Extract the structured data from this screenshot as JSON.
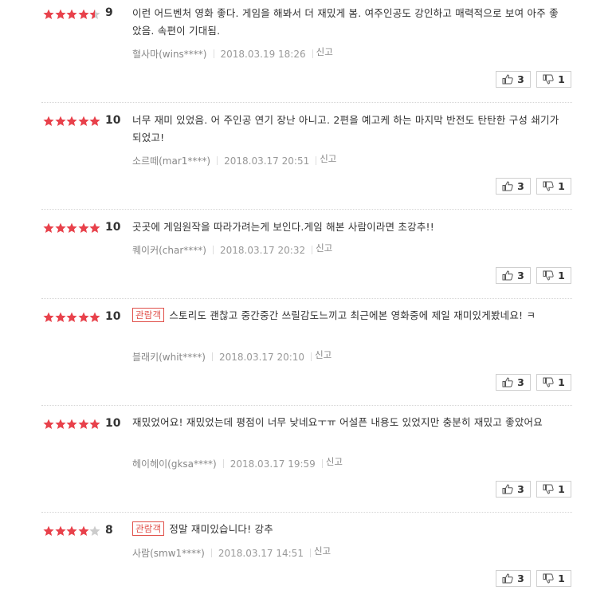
{
  "colors": {
    "star_on": "#e8414b",
    "star_off": "#cccccc",
    "badge": "#e0504a"
  },
  "reviews": [
    {
      "rating": 4.5,
      "score": "9",
      "badge": "",
      "text": "이런 어드벤처 영화 좋다. 게임을 해봐서 더 재밌게 봄. 여주인공도 강인하고 매력적으로 보여 아주 좋았음. 속편이 기대됨.",
      "author": "혈사마(wins****)",
      "date": "2018.03.19 18:26",
      "report": "신고",
      "likes": "3",
      "dislikes": "1"
    },
    {
      "rating": 5,
      "score": "10",
      "badge": "",
      "text": "너무 재미 있었음. 어 주인공 연기 장난 아니고. 2편을 예고케 하는 마지막 반전도 탄탄한 구성 쇄기가 되었고!",
      "author": "소르떼(mar1****)",
      "date": "2018.03.17 20:51",
      "report": "신고",
      "likes": "3",
      "dislikes": "1"
    },
    {
      "rating": 5,
      "score": "10",
      "badge": "",
      "text": "곳곳에 게임원작을 따라가려는게 보인다.게임 해본 사람이라면 초강추!!",
      "author": "퀘이커(char****)",
      "date": "2018.03.17 20:32",
      "report": "신고",
      "likes": "3",
      "dislikes": "1"
    },
    {
      "rating": 5,
      "score": "10",
      "badge": "관람객",
      "text": "스토리도 괜찮고 중간중간 쓰릴감도느끼고 최근에본 영화중에 제일 재미있게봤네요! ㅋ",
      "author": "블래키(whit****)",
      "date": "2018.03.17 20:10",
      "report": "신고",
      "likes": "3",
      "dislikes": "1"
    },
    {
      "rating": 5,
      "score": "10",
      "badge": "",
      "text": "재밌었어요! 재밌었는데 평점이 너무 낮네요ㅜㅠ 어설픈 내용도 있었지만 충분히 재밌고 좋았어요",
      "author": "헤이헤이(gksa****)",
      "date": "2018.03.17 19:59",
      "report": "신고",
      "likes": "3",
      "dislikes": "1"
    },
    {
      "rating": 4,
      "score": "8",
      "badge": "관람객",
      "text": "정말 재미있습니다! 강추",
      "author": "사람(smw1****)",
      "date": "2018.03.17 14:51",
      "report": "신고",
      "likes": "3",
      "dislikes": "1"
    }
  ]
}
